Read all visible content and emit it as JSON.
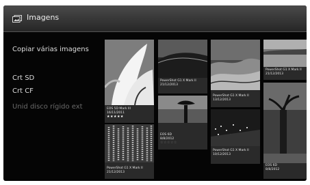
{
  "header": {
    "title": "Imagens",
    "icon": "pictures-icon"
  },
  "menu": {
    "items": [
      {
        "label": "Copiar várias imagens",
        "enabled": true
      },
      {
        "label": "Crt SD",
        "enabled": true
      },
      {
        "label": "Crt CF",
        "enabled": true
      },
      {
        "label": "Unid disco rígido ext",
        "enabled": false
      }
    ]
  },
  "thumbnails": [
    {
      "camera": "EOS 5D Mark III",
      "date": "16/11/2011",
      "stars": "★★★★★"
    },
    {
      "camera": "PowerShot G1 X Mark II",
      "date": "21/12/2013",
      "stars": ""
    },
    {
      "camera": "EOS 6D",
      "date": "8/8/2012",
      "stars": "☆☆☆☆☆"
    },
    {
      "camera": "PowerShot G1 X Mark II",
      "date": "21/12/2013",
      "stars": ""
    },
    {
      "camera": "PowerShot G1 X Mark II",
      "date": "13/12/2013",
      "stars": ""
    },
    {
      "camera": "PowerShot G1 X Mark II",
      "date": "21/12/2013",
      "stars": ""
    },
    {
      "camera": "PowerShot G1 X Mark II",
      "date": "10/12/2013",
      "stars": ""
    },
    {
      "camera": "EOS 6D",
      "date": "8/8/2012",
      "stars": ""
    }
  ]
}
